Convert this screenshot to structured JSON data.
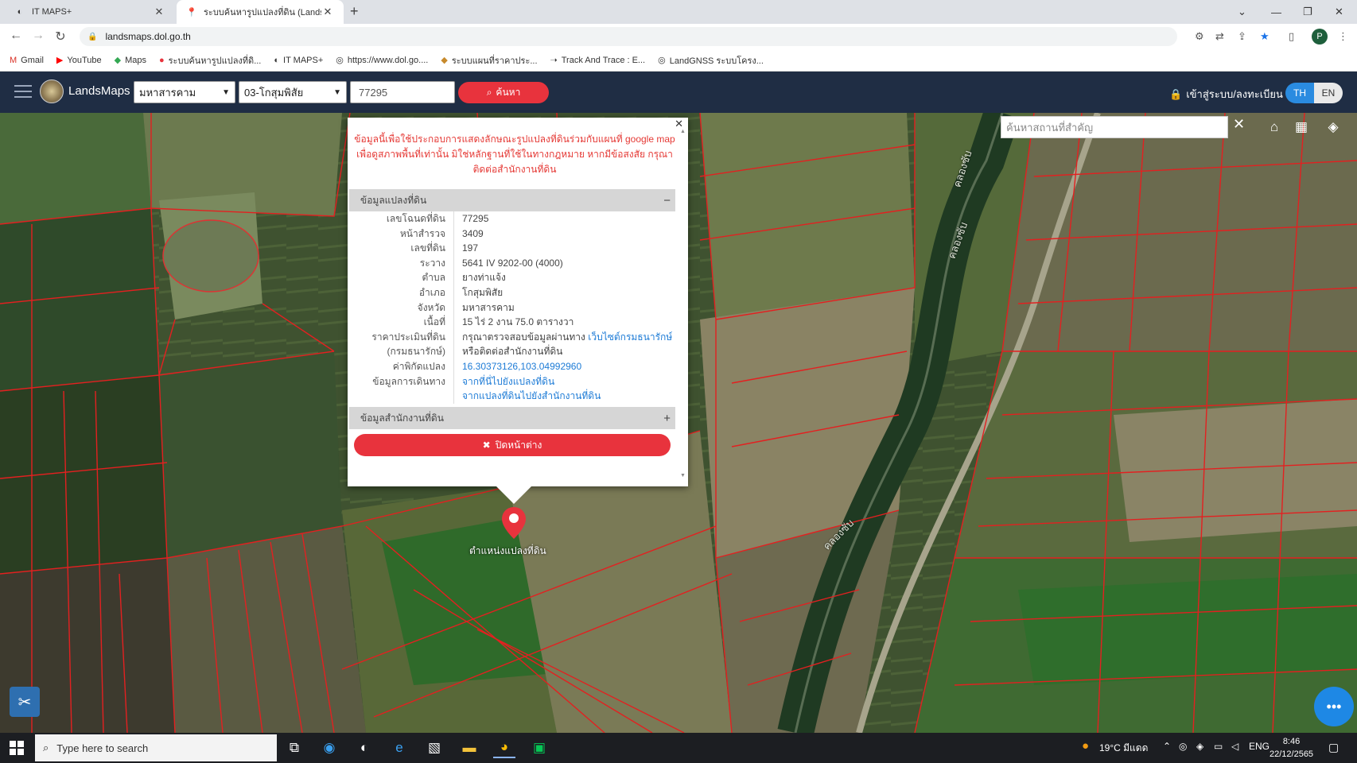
{
  "browser": {
    "tabs": [
      {
        "label": "IT MAPS+",
        "active": false
      },
      {
        "label": "ระบบค้นหารูปแปลงที่ดิน (LandsMaps",
        "active": true
      }
    ],
    "url": "landsmaps.dol.go.th",
    "profile_initial": "P",
    "bookmarks": [
      {
        "label": "Gmail",
        "icon": "gmail-icon"
      },
      {
        "label": "YouTube",
        "icon": "youtube-icon"
      },
      {
        "label": "Maps",
        "icon": "maps-icon"
      },
      {
        "label": "ระบบค้นหารูปแปลงที่ดิ...",
        "icon": "pin-icon"
      },
      {
        "label": "IT MAPS+",
        "icon": "itmaps-icon"
      },
      {
        "label": "https://www.dol.go....",
        "icon": "globe-icon"
      },
      {
        "label": "ระบบแผนที่ราคาประ...",
        "icon": "map-icon"
      },
      {
        "label": "Track And Trace : E...",
        "icon": "track-icon"
      },
      {
        "label": "LandGNSS ระบบโครง...",
        "icon": "globe-icon"
      }
    ]
  },
  "header": {
    "brand": "LandsMaps",
    "province": "มหาสารคาม",
    "district": "03-โกสุมพิสัย",
    "parcel_number": "77295",
    "search_label": "ค้นหา",
    "login_label": "เข้าสู่ระบบ/ลงทะเบียน",
    "lang_th": "TH",
    "lang_en": "EN"
  },
  "map": {
    "place_search_placeholder": "ค้นหาสถานที่สำคัญ",
    "pin_label": "ตำแหน่งแปลงที่ดิน",
    "road_label_1": "คลองซับ",
    "road_label_2": "คลองซับ",
    "road_label_3": "คลองซับ"
  },
  "popup": {
    "disclaimer_1": "ข้อมูลนี้เพื่อใช้ประกอบการแสดงลักษณะรูปแปลงที่ดินร่วมกับแผนที่ google map",
    "disclaimer_2": "เพื่อดูสภาพพื้นที่เท่านั้น มิใช่หลักฐานที่ใช้ในทางกฎหมาย หากมีข้อสงสัย กรุณา",
    "disclaimer_3": "ติดต่อสำนักงานที่ดิน",
    "section_parcel": "ข้อมูลแปลงที่ดิน",
    "section_office": "ข้อมูลสำนักงานที่ดิน",
    "rows": [
      {
        "k": "เลขโฉนดที่ดิน",
        "v": "77295"
      },
      {
        "k": "หน้าสำรวจ",
        "v": "3409"
      },
      {
        "k": "เลขที่ดิน",
        "v": "197"
      },
      {
        "k": "ระวาง",
        "v": "5641 IV 9202-00 (4000)"
      },
      {
        "k": "ตำบล",
        "v": "ยางท่าแจ้ง"
      },
      {
        "k": "อำเภอ",
        "v": "โกสุมพิสัย"
      },
      {
        "k": "จังหวัด",
        "v": "มหาสารคาม"
      },
      {
        "k": "เนื้อที่",
        "v": "15 ไร่ 2 งาน 75.0 ตารางวา"
      }
    ],
    "price_key_1": "ราคาประเมินที่ดิน",
    "price_key_2": "(กรมธนารักษ์)",
    "price_val_1": "กรุณาตรวจสอบข้อมูลผ่านทาง",
    "price_link": "เว็บไซต์กรมธนารักษ์",
    "price_val_2": "หรือติดต่อสำนักงานที่ดิน",
    "coord_key": "ค่าพิกัดแปลง",
    "coord_val": "16.30373126,103.04992960",
    "travel_key": "ข้อมูลการเดินทาง",
    "travel_link_1": "จากที่นี่ไปยังแปลงที่ดิน",
    "travel_link_2": "จากแปลงที่ดินไปยังสำนักงานที่ดิน",
    "close_label": "ปิดหน้าต่าง"
  },
  "taskbar": {
    "search_placeholder": "Type here to search",
    "weather": "19°C มีแดด",
    "lang": "ENG",
    "time": "8:46",
    "date": "22/12/2565"
  }
}
